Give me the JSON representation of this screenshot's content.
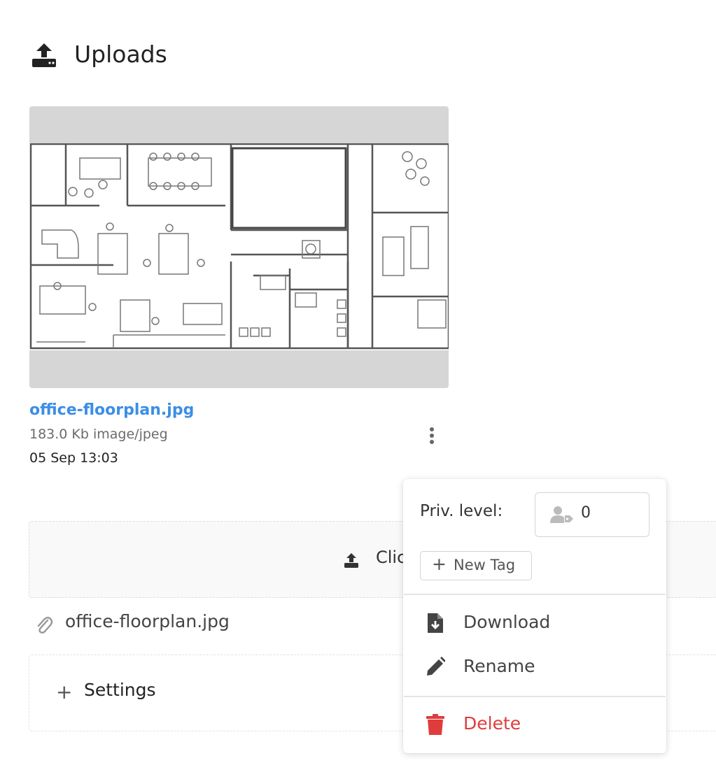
{
  "header": {
    "title": "Uploads",
    "icon": "upload-icon"
  },
  "file": {
    "name": "office-floorplan.jpg",
    "meta": "183.0 Kb image/jpeg",
    "date": "05 Sep 13:03"
  },
  "dropzone": {
    "label": "Clic",
    "icon": "upload-icon"
  },
  "attachment": {
    "name": "office-floorplan.jpg",
    "icon": "paperclip-icon"
  },
  "settings": {
    "label": "Settings",
    "icon": "plus-icon"
  },
  "menu": {
    "priv_label": "Priv. level:",
    "priv_value": "0",
    "priv_icon": "user-tag-icon",
    "new_tag": "New Tag",
    "items": [
      {
        "label": "Download",
        "icon": "file-download-icon"
      },
      {
        "label": "Rename",
        "icon": "pencil-icon"
      },
      {
        "label": "Delete",
        "icon": "trash-icon"
      }
    ]
  },
  "colors": {
    "link": "#3b8ee6",
    "danger": "#e03c3c",
    "thumb_bg": "#d6d6d6"
  }
}
